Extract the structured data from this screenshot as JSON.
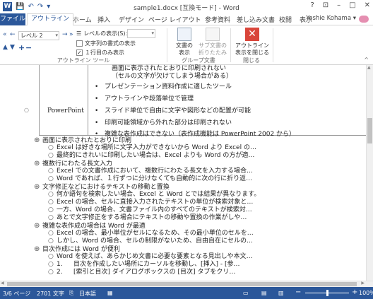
{
  "window": {
    "title": "sample1.docx [互換モード] - Word",
    "controls": [
      "?",
      "⊡",
      "–",
      "□",
      "✕"
    ]
  },
  "quick_access": {
    "save": "💾",
    "undo": "↶",
    "redo": "↷",
    "customize": "▾"
  },
  "tabs": {
    "file": "ファイル",
    "items": [
      "アウトライン",
      "ホーム",
      "挿入",
      "デザイン",
      "ページ レイアウト",
      "参考資料",
      "差し込み文書",
      "校閲",
      "表示"
    ],
    "user": "Yoshie Kohama ▾"
  },
  "ribbon": {
    "outline_tools": {
      "level_value": "レベル 2",
      "show_level_label": "レベルの表示(S):",
      "show_level_value": "",
      "show_formatting": "文字列の書式の表示",
      "show_first_line": "１行目のみ表示",
      "group_label": "アウトライン ツール"
    },
    "master_document": {
      "show_document": "文書の\n表示",
      "collapse_subdocs": "サブ文書の\n折りたたみ",
      "group_label": "グループ文書"
    },
    "close": {
      "label": "アウトライン\n表示を閉じる",
      "group_label": "閉じる"
    }
  },
  "document": {
    "table": {
      "row_label": "PowerPoint",
      "items": [
        {
          "text": "画面に表示されたとおりに印刷されない",
          "bullet": false,
          "indent": true
        },
        {
          "text": "（セルの文字が欠けてしまう場合がある）",
          "bullet": false,
          "indent": true
        },
        {
          "text": "プレゼンテーション資料作成に適したツール",
          "bullet": true,
          "indent": false
        },
        {
          "text": "アウトラインや段落単位で管理",
          "bullet": true,
          "indent": false
        },
        {
          "text": "スライド単位で自由に文字や図形などの配置が可能",
          "bullet": true,
          "indent": false
        },
        {
          "text": "印刷可能領域から外れた部分は印刷されない",
          "bullet": true,
          "indent": false
        },
        {
          "text": "複雑な表作成はできない（表作成機能は PowerPoint 2002 から）",
          "bullet": true,
          "indent": false
        }
      ]
    },
    "outline": [
      {
        "level": 1,
        "text": "画面に表示されたとおりに印刷"
      },
      {
        "level": 2,
        "text": "Excel は好きな場所に文字入力ができないから Word より Excel の…"
      },
      {
        "level": 2,
        "text": "最終的にきれいに印刷したい場合は、Excel よりも Word の方が適…"
      },
      {
        "level": 1,
        "text": "複数行にわたる長文入力"
      },
      {
        "level": 2,
        "text": "Excel での文書作成において、複数行にわたる長文を入力する場合…"
      },
      {
        "level": 2,
        "text": "Word であれば、１行ずつに分けなくても自動的に次の行に折り返…"
      },
      {
        "level": 1,
        "text": "文字修正などにおけるテキストの移動と置換"
      },
      {
        "level": 2,
        "text": "何か語句を検索したい場合、Excel と Word とでは結果が異なります。"
      },
      {
        "level": 2,
        "text": "Excel の場合、セルに直接入力されたテキストの単位が検索対象と…"
      },
      {
        "level": 2,
        "text": "一方、Word の場合、文書ファイル内のすべてのテキストが検索対…"
      },
      {
        "level": 2,
        "text": "あとで文字修正をする場合にテキストの移動や置換の作業がしや…"
      },
      {
        "level": 1,
        "text": "複雑な表作成の場合は Word が最適"
      },
      {
        "level": 2,
        "text": "Excel の場合、最小単位がセルになるため、その最小単位のセルを…"
      },
      {
        "level": 2,
        "text": "しかし、Word の場合、セルの制限がないため、自由自在にセルの…"
      },
      {
        "level": 1,
        "text": "目次作成には Word が便利"
      },
      {
        "level": 2,
        "text": "Word を使えば、あらかじめ文書に必要な要素となる見出しや本文…"
      },
      {
        "level": 2,
        "marker": "1.",
        "text": "目次を作成したい場所にカーソルを移動し、[挿入] - [参…"
      },
      {
        "level": 2,
        "marker": "2.",
        "text": "[索引と目次] ダイアログボックスの [目次] タブをクリ…"
      }
    ]
  },
  "status": {
    "page": "3/6 ページ",
    "words": "2701 文字",
    "language": "日本語",
    "zoom": "100%"
  },
  "colors": {
    "accent": "#2b579a",
    "close_button": "#d9453a"
  }
}
